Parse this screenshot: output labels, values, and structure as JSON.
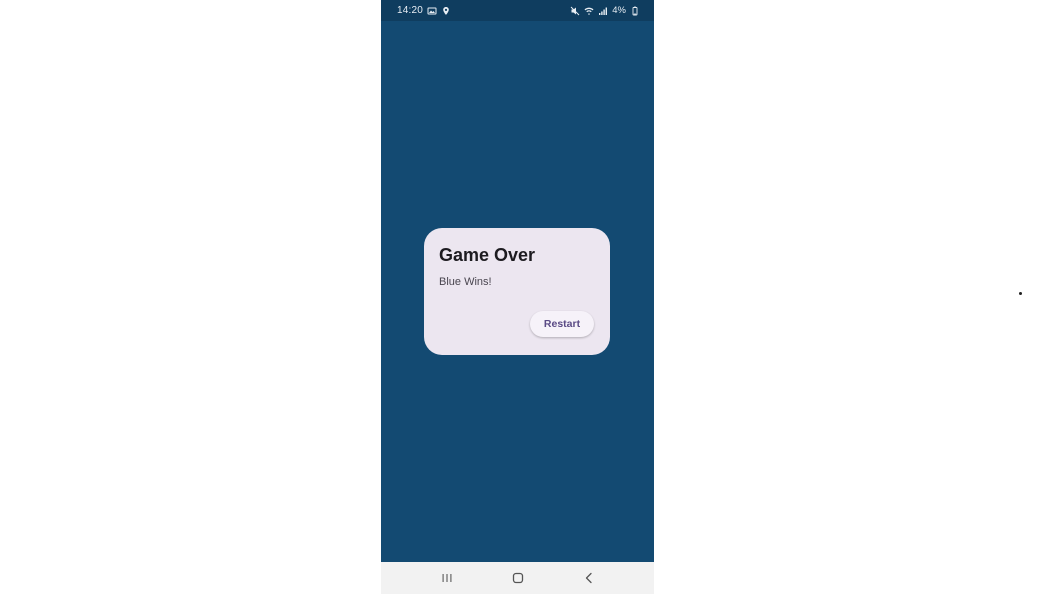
{
  "status_bar": {
    "time": "14:20",
    "battery": "4%",
    "left_icons": [
      "image-icon",
      "location-icon"
    ],
    "right_icons": [
      "mute-icon",
      "wifi-icon",
      "signal-icon",
      "battery-icon"
    ]
  },
  "dialog": {
    "title": "Game Over",
    "message": "Blue Wins!",
    "restart_label": "Restart"
  },
  "nav_bar": {
    "buttons": [
      "recent-apps-icon",
      "home-icon",
      "back-icon"
    ]
  },
  "colors": {
    "background": "#134a72",
    "status_bar": "#0f3d5f",
    "dialog": "#ece6f0",
    "button_text": "#5a4a85",
    "nav_bar": "#f2f2f2"
  }
}
